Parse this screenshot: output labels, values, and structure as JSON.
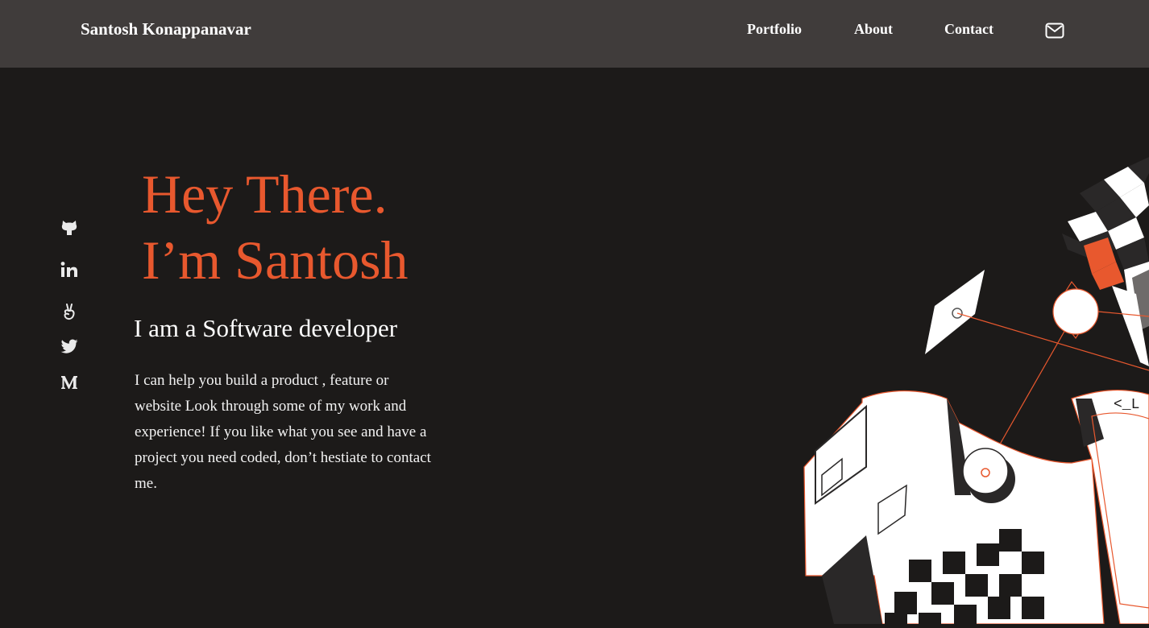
{
  "header": {
    "brand": "Santosh Konappanavar",
    "nav": [
      "Portfolio",
      "About",
      "Contact"
    ],
    "mail_icon": "mail-icon"
  },
  "socials": [
    {
      "name": "github",
      "icon": "github-icon"
    },
    {
      "name": "linkedin",
      "icon": "linkedin-icon"
    },
    {
      "name": "angellist",
      "icon": "angellist-icon"
    },
    {
      "name": "twitter",
      "icon": "twitter-icon"
    },
    {
      "name": "medium",
      "icon": "medium-icon"
    }
  ],
  "hero": {
    "greeting_line1": "Hey There.",
    "greeting_line2": "I’m Santosh",
    "role": "I am a Software developer",
    "bio": "I can help you build a product , feature or website Look through some of my work and experience! If you like what you see and have a project you need coded, don’t hestiate to contact me."
  },
  "colors": {
    "accent": "#e8582e",
    "header_bg": "#403c3b",
    "page_bg": "#1c1a19",
    "text": "#ffffff"
  }
}
